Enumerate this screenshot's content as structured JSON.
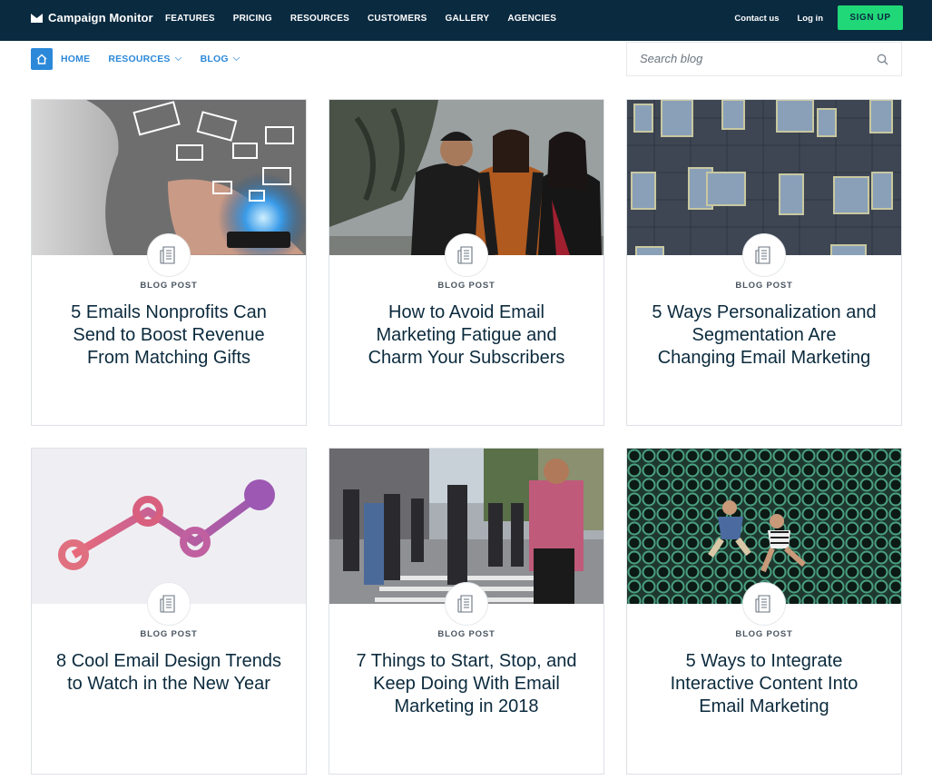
{
  "topnav": {
    "brand": "Campaign Monitor",
    "links": [
      "FEATURES",
      "PRICING",
      "RESOURCES",
      "CUSTOMERS",
      "GALLERY",
      "AGENCIES"
    ],
    "contact": "Contact us",
    "login": "Log in",
    "signup": "SIGN UP"
  },
  "subnav": {
    "home": "HOME",
    "resources": "RESOURCES",
    "blog": "BLOG"
  },
  "search": {
    "placeholder": "Search blog"
  },
  "colors": {
    "navy": "#0a2a40",
    "accent": "#2c89d9",
    "signup": "#20d878"
  },
  "cards": [
    {
      "type": "BLOG POST",
      "title": "5 Emails Nonprofits Can Send to Boost Revenue From Matching Gifts",
      "image": "hand-phone-emails"
    },
    {
      "type": "BLOG POST",
      "title": "How to Avoid Email Marketing Fatigue and Charm Your Subscribers",
      "image": "three-friends-laughing"
    },
    {
      "type": "BLOG POST",
      "title": "5 Ways Personalization and Segmentation Are Changing Email Marketing",
      "image": "building-facade-windows"
    },
    {
      "type": "BLOG POST",
      "title": "8 Cool Email Design Trends to Watch in the New Year",
      "image": "gradient-line-graph"
    },
    {
      "type": "BLOG POST",
      "title": "7 Things to Start, Stop, and Keep Doing With Email Marketing in 2018",
      "image": "street-crosswalk-crowd"
    },
    {
      "type": "BLOG POST",
      "title": "5 Ways to Integrate Interactive Content Into Email Marketing",
      "image": "jumping-on-pipes"
    }
  ]
}
